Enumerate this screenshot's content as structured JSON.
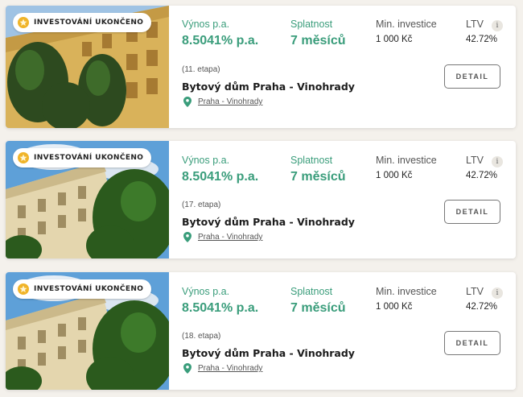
{
  "cards": [
    {
      "badge": "INVESTOVÁNÍ UKONČENO",
      "yield_label": "Výnos p.a.",
      "yield_value": "8.5041% p.a.",
      "maturity_label": "Splatnost",
      "maturity_value": "7 měsíců",
      "min_label": "Min. investice",
      "min_value": "1 000 Kč",
      "ltv_label": "LTV",
      "ltv_value": "42.72%",
      "info_glyph": "i",
      "stage": "(11. etapa)",
      "title": "Bytový dům Praha - Vinohrady",
      "location": "Praha - Vinohrady",
      "button": "DETAIL"
    },
    {
      "badge": "INVESTOVÁNÍ UKONČENO",
      "yield_label": "Výnos p.a.",
      "yield_value": "8.5041% p.a.",
      "maturity_label": "Splatnost",
      "maturity_value": "7 měsíců",
      "min_label": "Min. investice",
      "min_value": "1 000 Kč",
      "ltv_label": "LTV",
      "ltv_value": "42.72%",
      "info_glyph": "i",
      "stage": "(17. etapa)",
      "title": "Bytový dům Praha - Vinohrady",
      "location": "Praha - Vinohrady",
      "button": "DETAIL"
    },
    {
      "badge": "INVESTOVÁNÍ UKONČENO",
      "yield_label": "Výnos p.a.",
      "yield_value": "8.5041% p.a.",
      "maturity_label": "Splatnost",
      "maturity_value": "7 měsíců",
      "min_label": "Min. investice",
      "min_value": "1 000 Kč",
      "ltv_label": "LTV",
      "ltv_value": "42.72%",
      "info_glyph": "i",
      "stage": "(18. etapa)",
      "title": "Bytový dům Praha - Vinohrady",
      "location": "Praha - Vinohrady",
      "button": "DETAIL"
    }
  ],
  "colors": {
    "accent": "#3a9d7b",
    "background": "#f4f1ec",
    "star": "#f0b429"
  },
  "icons": [
    "star-icon",
    "info-icon",
    "location-pin-icon"
  ]
}
